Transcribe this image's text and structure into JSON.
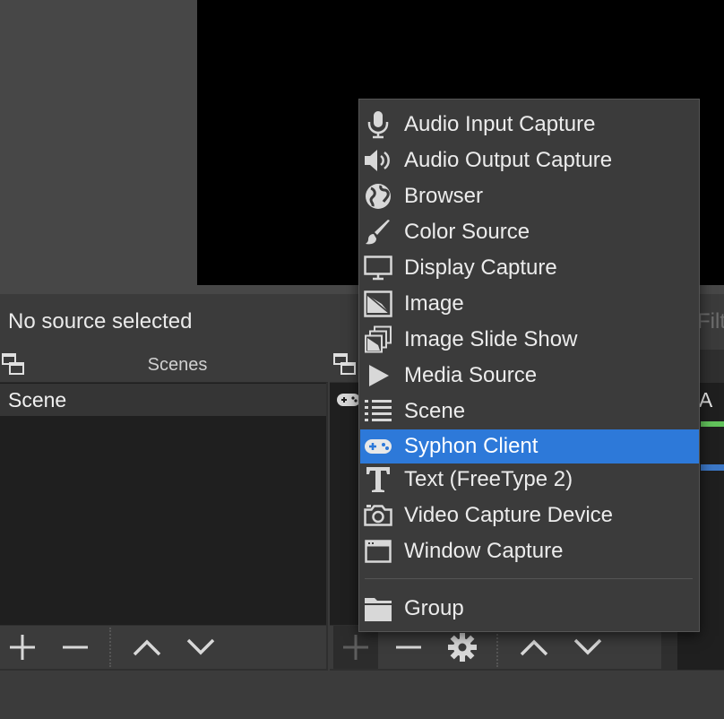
{
  "context_bar": {
    "status_text": "No source selected",
    "filters_text": "Filt"
  },
  "scenes": {
    "title": "Scenes",
    "items": [
      {
        "label": "Scene",
        "selected": true
      }
    ]
  },
  "mixer": {
    "label_partial": "c/A"
  },
  "menu": {
    "items": [
      {
        "label": "Audio Input Capture",
        "icon": "microphone-icon"
      },
      {
        "label": "Audio Output Capture",
        "icon": "speaker-icon"
      },
      {
        "label": "Browser",
        "icon": "globe-icon"
      },
      {
        "label": "Color Source",
        "icon": "paintbrush-icon"
      },
      {
        "label": "Display Capture",
        "icon": "monitor-icon"
      },
      {
        "label": "Image",
        "icon": "image-icon"
      },
      {
        "label": "Image Slide Show",
        "icon": "slideshow-icon"
      },
      {
        "label": "Media Source",
        "icon": "play-icon"
      },
      {
        "label": "Scene",
        "icon": "list-icon"
      },
      {
        "label": "Syphon Client",
        "icon": "gamepad-icon",
        "highlighted": true
      },
      {
        "label": "Text (FreeType 2)",
        "icon": "text-icon"
      },
      {
        "label": "Video Capture Device",
        "icon": "camera-icon"
      },
      {
        "label": "Window Capture",
        "icon": "window-icon"
      },
      {
        "label": "Group",
        "icon": "folder-icon"
      }
    ]
  },
  "colors": {
    "highlight": "#2d79d9",
    "menu_bg": "#3b3b3b",
    "preview": "#000000"
  }
}
